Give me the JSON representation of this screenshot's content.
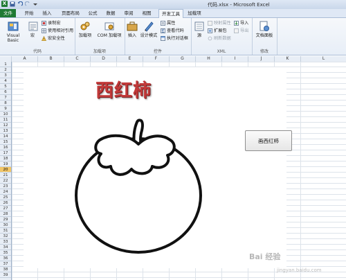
{
  "window": {
    "title": "代码.xlsx - Microsoft Excel",
    "app_icon_letter": "X"
  },
  "quick_access": {
    "icons": [
      "save-icon",
      "undo-icon",
      "redo-icon",
      "customize-icon"
    ]
  },
  "tabs": [
    {
      "label": "文件",
      "name": "tab-file"
    },
    {
      "label": "开始",
      "name": "tab-home"
    },
    {
      "label": "插入",
      "name": "tab-insert"
    },
    {
      "label": "页面布局",
      "name": "tab-page-layout"
    },
    {
      "label": "公式",
      "name": "tab-formulas"
    },
    {
      "label": "数据",
      "name": "tab-data"
    },
    {
      "label": "审阅",
      "name": "tab-review"
    },
    {
      "label": "视图",
      "name": "tab-view"
    },
    {
      "label": "开发工具",
      "name": "tab-developer",
      "active": true
    },
    {
      "label": "加载项",
      "name": "tab-addins"
    }
  ],
  "ribbon": {
    "code": {
      "label": "代码",
      "visual_basic": "Visual Basic",
      "macros": "宏",
      "record_macro": "录制宏",
      "relative_refs": "使用相对引用",
      "macro_security": "宏安全性"
    },
    "addins": {
      "label": "加载项",
      "addins": "加载项",
      "com_addins": "COM 加载项"
    },
    "controls": {
      "label": "控件",
      "insert": "插入",
      "design_mode": "设计模式",
      "properties": "属性",
      "view_code": "查看代码",
      "run_dialog": "执行对话框"
    },
    "xml": {
      "label": "XML",
      "source": "源",
      "map_properties": "映射属性",
      "expansion_packs": "扩展包",
      "refresh_data": "刷新数据",
      "import": "导入",
      "export": "导出"
    },
    "modify": {
      "label": "修改",
      "document_panel": "文档面板"
    }
  },
  "sheet": {
    "columns": [
      "A",
      "B",
      "C",
      "D",
      "E",
      "F",
      "G",
      "H",
      "I",
      "J",
      "K",
      "L"
    ],
    "rows": [
      "1",
      "2",
      "3",
      "4",
      "5",
      "6",
      "7",
      "8",
      "9",
      "10",
      "11",
      "12",
      "13",
      "14",
      "15",
      "16",
      "17",
      "18",
      "19",
      "20",
      "21",
      "22",
      "23",
      "24",
      "25",
      "26",
      "27",
      "28",
      "29",
      "30",
      "31",
      "32",
      "33",
      "34",
      "35",
      "36",
      "37",
      "38",
      "39"
    ],
    "selected_row": "20",
    "wordart_title": "西红柿",
    "button_label": "画西红柿"
  },
  "watermark": {
    "text": "Bai 经验",
    "sub": "jingyan.baidu.com"
  },
  "colors": {
    "file_tab": "#1f7a33",
    "title_red": "#c23a3a",
    "selected_row": "#f3c667"
  }
}
